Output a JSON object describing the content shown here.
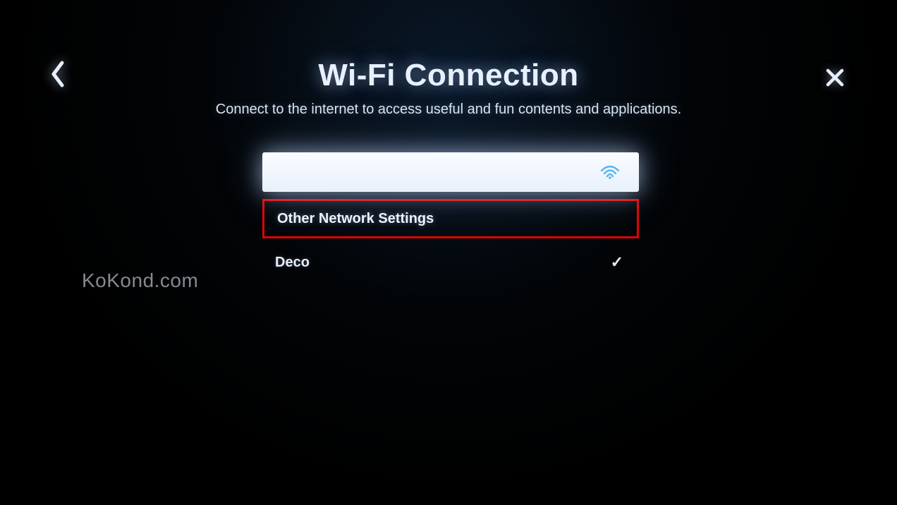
{
  "header": {
    "title": "Wi-Fi Connection",
    "subtitle": "Connect to the internet to access useful and fun contents and applications."
  },
  "list": {
    "selected_label": "",
    "other_label": "Other Network Settings",
    "deco_label": "Deco"
  },
  "watermark": "KoKond.com",
  "colors": {
    "highlight_border": "#e40000",
    "text": "#e8f0ff"
  }
}
